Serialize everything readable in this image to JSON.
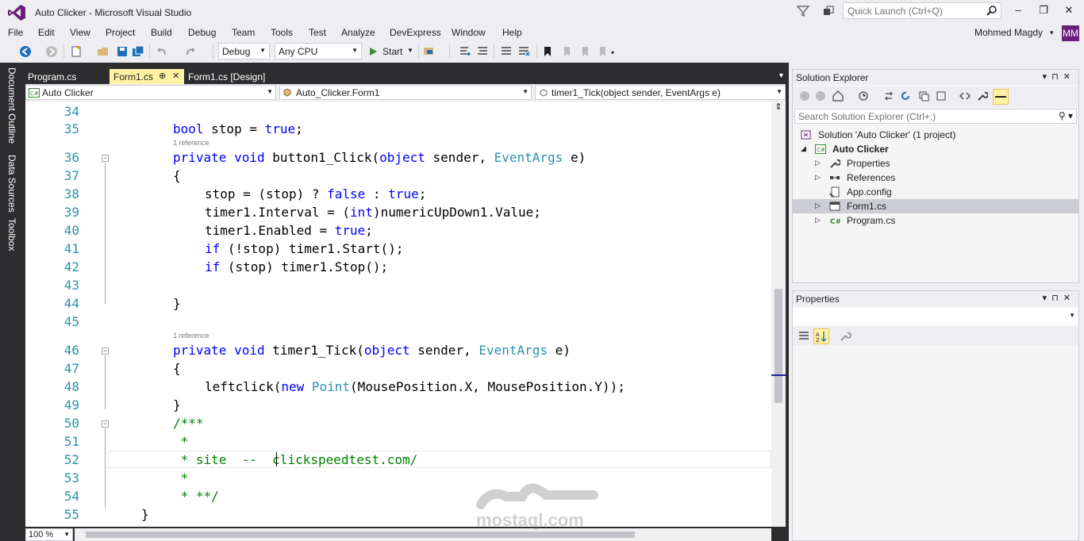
{
  "window": {
    "title": "Auto Clicker - Microsoft Visual Studio",
    "quick_launch_placeholder": "Quick Launch (Ctrl+Q)",
    "user_name": "Mohmed Magdy",
    "avatar_initials": "MM"
  },
  "menu": [
    "File",
    "Edit",
    "View",
    "Project",
    "Build",
    "Debug",
    "Team",
    "Tools",
    "Test",
    "Analyze",
    "DevExpress",
    "Window",
    "Help"
  ],
  "toolbar": {
    "config": "Debug",
    "platform": "Any CPU",
    "start_label": "Start"
  },
  "left_rail": [
    "Document Outline",
    "Data Sources",
    "Toolbox"
  ],
  "doc_tabs": [
    {
      "label": "Program.cs",
      "active": false
    },
    {
      "label": "Form1.cs",
      "active": true,
      "pin": "⊕"
    },
    {
      "label": "Form1.cs [Design]",
      "active": false
    }
  ],
  "navbar": {
    "project": "Auto Clicker",
    "class": "Auto_Clicker.Form1",
    "member": "timer1_Tick(object sender, EventArgs e)"
  },
  "editor": {
    "line_numbers": [
      "34",
      "35",
      "36",
      "37",
      "38",
      "39",
      "40",
      "41",
      "42",
      "43",
      "44",
      "45",
      "46",
      "47",
      "48",
      "49",
      "50",
      "51",
      "52",
      "53",
      "54",
      "55"
    ],
    "references": [
      "1 reference",
      "1 reference"
    ],
    "zoom": "100 %",
    "code": {
      "l35": [
        "bool",
        " stop = ",
        "true",
        ";"
      ],
      "l36": [
        "private",
        " ",
        "void",
        " button1_Click(",
        "object",
        " sender, ",
        "EventArgs",
        " e)"
      ],
      "l37": "{",
      "l38": [
        "stop = (stop) ? ",
        "false",
        " : ",
        "true",
        ";"
      ],
      "l39": [
        "timer1.Interval = (",
        "int",
        ")numericUpDown1.Value;"
      ],
      "l40": [
        "timer1.Enabled = ",
        "true",
        ";"
      ],
      "l41": [
        "if",
        " (!stop) timer1.Start();"
      ],
      "l42": [
        "if",
        " (stop) timer1.Stop();"
      ],
      "l44": "}",
      "l46": [
        "private",
        " ",
        "void",
        " timer1_Tick(",
        "object",
        " sender, ",
        "EventArgs",
        " e)"
      ],
      "l47": "{",
      "l48": [
        "leftclick(",
        "new",
        " ",
        "Point",
        "(MousePosition.X, MousePosition.Y));"
      ],
      "l49": "}",
      "l50": "/***",
      "l51": " *",
      "l52": " * site  --  clickspeedtest.com/",
      "l53": " *",
      "l54": " * **/",
      "l55": "}"
    }
  },
  "solution_explorer": {
    "title": "Solution Explorer",
    "search_placeholder": "Search Solution Explorer (Ctrl+;)",
    "tree": [
      {
        "label": "Solution 'Auto Clicker' (1 project)",
        "level": 0,
        "icon": "solution-icon"
      },
      {
        "label": "Auto Clicker",
        "level": 1,
        "icon": "csharp-project-icon",
        "bold": true
      },
      {
        "label": "Properties",
        "level": 2,
        "icon": "wrench-icon"
      },
      {
        "label": "References",
        "level": 2,
        "icon": "references-icon"
      },
      {
        "label": "App.config",
        "level": 2,
        "icon": "config-icon"
      },
      {
        "label": "Form1.cs",
        "level": 2,
        "icon": "form-icon",
        "selected": true
      },
      {
        "label": "Program.cs",
        "level": 2,
        "icon": "csharp-file-icon"
      }
    ]
  },
  "properties": {
    "title": "Properties"
  },
  "watermark": {
    "text": "mostaql.com"
  },
  "colors": {
    "keyword": "#0000ff",
    "type": "#2b91af",
    "comment": "#008000",
    "accent": "#68217a"
  }
}
